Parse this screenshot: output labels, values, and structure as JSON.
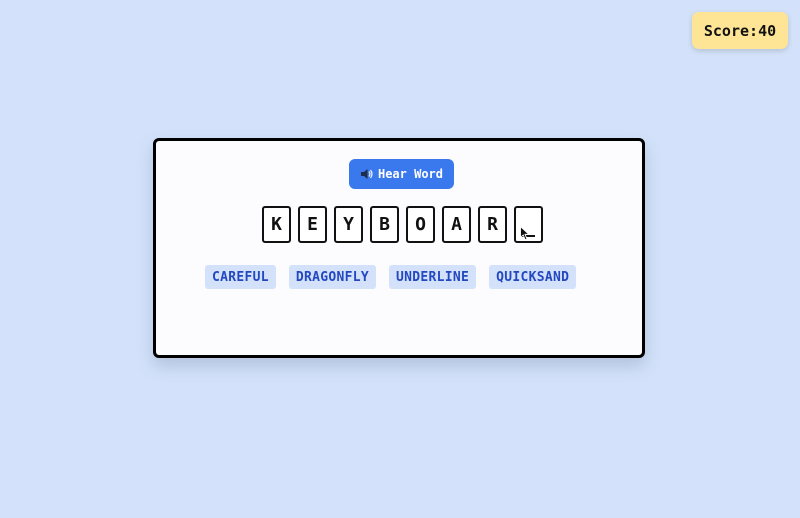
{
  "score": {
    "label": "Score:",
    "value": "40"
  },
  "hear_button": {
    "label": "Hear Word",
    "icon": "speaker-icon"
  },
  "tiles": [
    {
      "letter": "K"
    },
    {
      "letter": "E"
    },
    {
      "letter": "Y"
    },
    {
      "letter": "B"
    },
    {
      "letter": "O"
    },
    {
      "letter": "A"
    },
    {
      "letter": "R"
    },
    {
      "letter": ""
    }
  ],
  "options": [
    {
      "label": "CAREFUL"
    },
    {
      "label": "DRAGONFLY"
    },
    {
      "label": "UNDERLINE"
    },
    {
      "label": "QUICKSAND"
    }
  ],
  "colors": {
    "background": "#d3e2fa",
    "score_badge": "#fde595",
    "button": "#3a78ee",
    "option_text": "#2348c0"
  }
}
